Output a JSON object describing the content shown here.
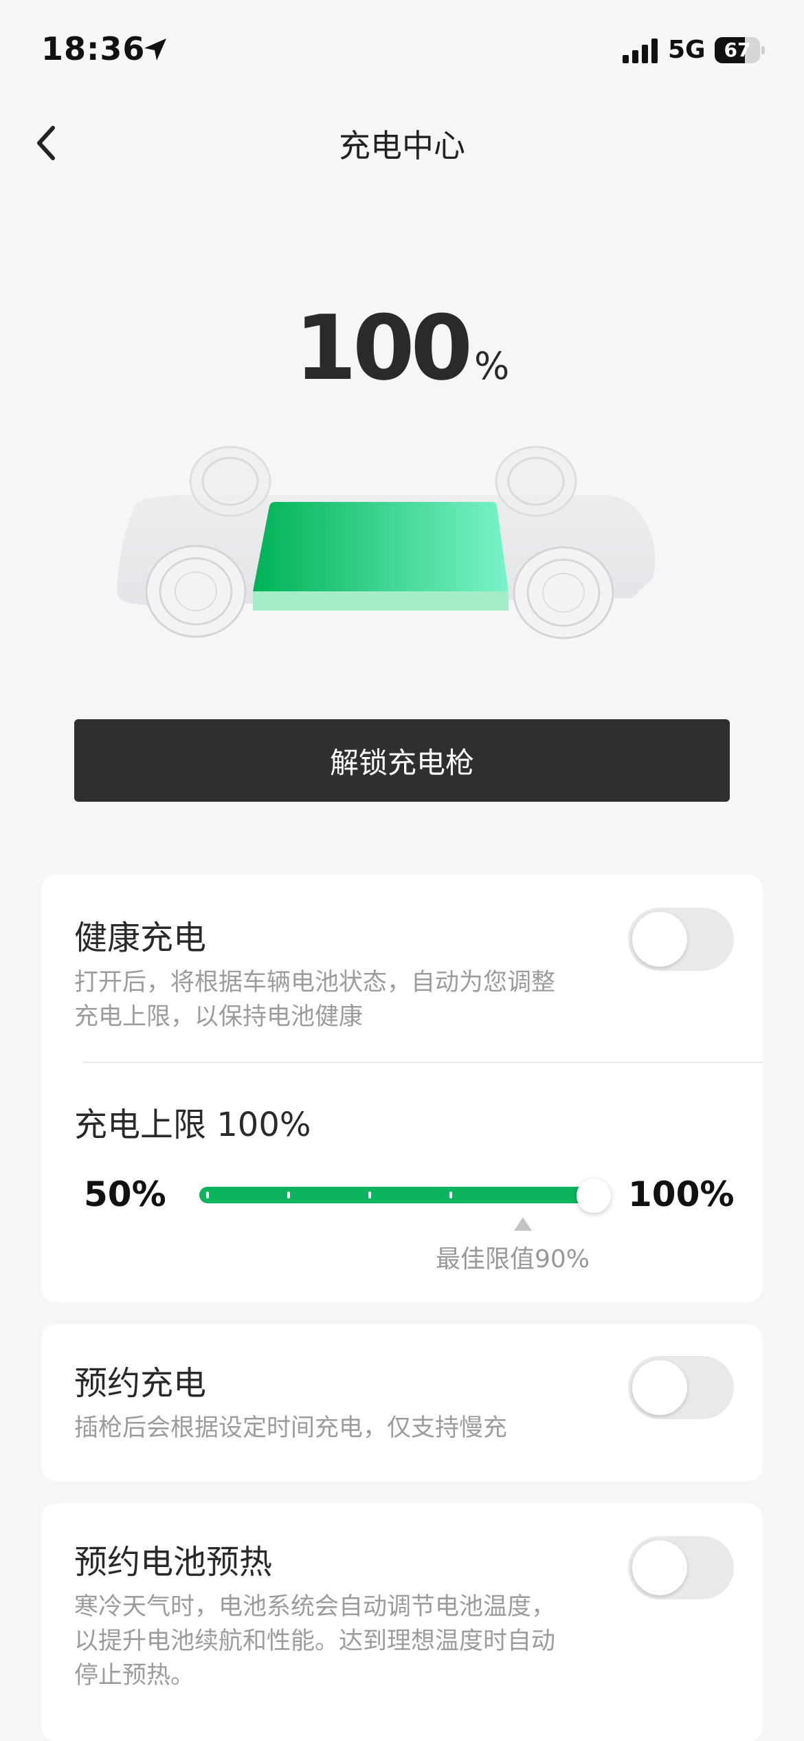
{
  "status_bar": {
    "time": "18:36",
    "network": "5G",
    "battery_level": 67,
    "battery_text": "67"
  },
  "nav": {
    "title": "充电中心"
  },
  "charge": {
    "value": "100",
    "unit": "%",
    "level": 100
  },
  "actions": {
    "unlock_label": "解锁充电枪"
  },
  "health_charging": {
    "title": "健康充电",
    "description": "打开后，将根据车辆电池状态，自动为您调整充电上限，以保持电池健康",
    "enabled": false
  },
  "charge_limit": {
    "label": "充电上限 100%",
    "min_label": "50%",
    "max_label": "100%",
    "min": 50,
    "max": 100,
    "value": 100,
    "optimal_label": "最佳限值90%",
    "optimal": 90
  },
  "scheduled_charging": {
    "title": "预约充电",
    "description": "插枪后会根据设定时间充电，仅支持慢充",
    "enabled": false
  },
  "battery_preheat": {
    "title": "预约电池预热",
    "description": "寒冷天气时，电池系统会自动调节电池温度，以提升电池续航和性能。达到理想温度时自动停止预热。",
    "enabled": false
  },
  "colors": {
    "accent_green": "#0db45e",
    "button_dark": "#2f2f2f",
    "background": "#f5f6f8"
  },
  "icons": {
    "back": "chevron-left-icon",
    "location": "location-arrow-icon",
    "signal": "cellular-signal-icon",
    "battery": "battery-icon"
  }
}
